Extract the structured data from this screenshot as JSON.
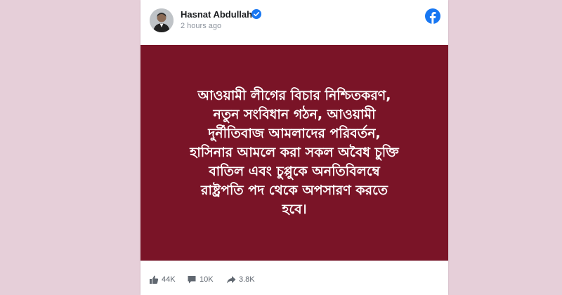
{
  "post": {
    "author": "Hasnat Abdullah",
    "timestamp": "2 hours ago",
    "text": "আওয়ামী লীগের বিচার নিশ্চিতকরণ,\nনতুন সংবিধান গঠন, আওয়ামী\nদুর্নীতিবাজ আমলাদের পরিবর্তন,\nহাসিনার আমলে করা সকল অবৈধ চুক্তি\nবাতিল এবং চুপ্পুকে অনতিবিলম্বে\nরাষ্ট্রপতি পদ থেকে অপসারণ করতে\nহবে।",
    "image_background": "#7a1427"
  },
  "stats": {
    "likes": "44K",
    "comments": "10K",
    "shares": "3.8K"
  },
  "icons": {
    "verified": "verified-badge-icon",
    "facebook": "facebook-logo-icon",
    "like": "thumbs-up-icon",
    "comment": "comment-bubble-icon",
    "share": "share-arrow-icon"
  },
  "colors": {
    "page_background": "#e6cfd9",
    "facebook_blue": "#1877f2",
    "post_background": "#7a1427"
  }
}
